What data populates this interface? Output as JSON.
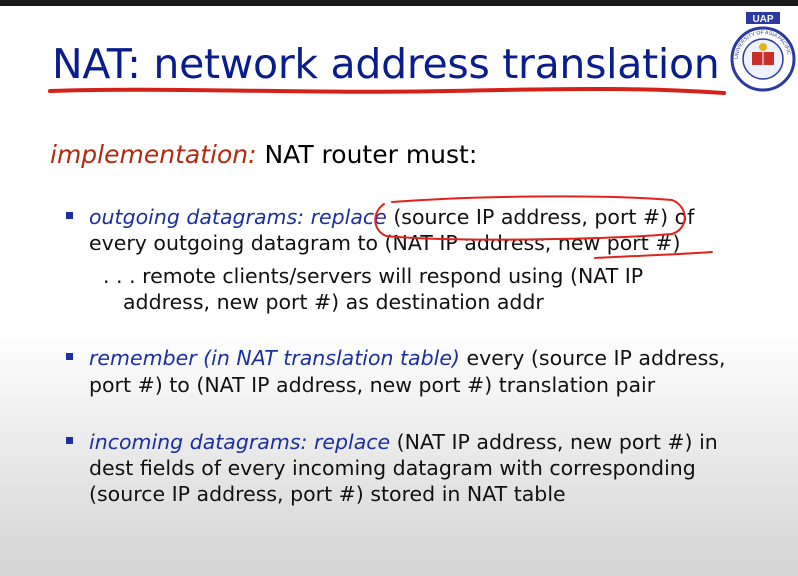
{
  "slide": {
    "title": "NAT: network address translation",
    "subhead_label": "implementation:",
    "subhead_text": " NAT router must:"
  },
  "bullets": [
    {
      "lines": [
        {
          "em": "outgoing datagrams: replace ",
          "text": "(source IP address, port #) of"
        },
        {
          "text": "every outgoing datagram to (NAT IP address, new port #)"
        }
      ],
      "sub_lines": [
        ". . . remote clients/servers will respond using (NAT IP",
        "address, new port #) as destination addr"
      ]
    },
    {
      "lines": [
        {
          "em": "remember (in NAT translation table)",
          "text": " every (source IP address,"
        },
        {
          "text": "port #)  to (NAT IP address, new port #) translation pair"
        }
      ]
    },
    {
      "lines": [
        {
          "em": "incoming datagrams: replace",
          "text": " (NAT IP address, new port #) in"
        },
        {
          "text": "dest fields of every incoming datagram with corresponding"
        },
        {
          "text": "(source IP address, port #) stored in NAT table"
        }
      ]
    }
  ],
  "logo": {
    "abbr": "UAP",
    "ring_text": "UNIVERSITY OF ASIA PACIFIC"
  },
  "colors": {
    "title": "#0a1d8c",
    "accent_red": "#b02a10",
    "bullet_blue": "#1c2fa0",
    "annotation_ink": "#e0241a"
  }
}
